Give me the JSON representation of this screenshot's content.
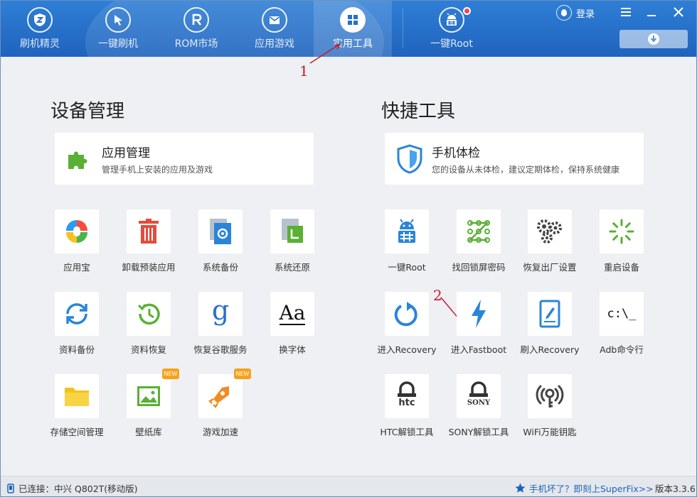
{
  "nav": {
    "tabs": [
      {
        "label": "刷机精灵",
        "icon": "shield-icon"
      },
      {
        "label": "一键刷机",
        "icon": "cursor-icon"
      },
      {
        "label": "ROM市场",
        "icon": "r-icon"
      },
      {
        "label": "应用游戏",
        "icon": "mail-icon"
      },
      {
        "label": "实用工具",
        "icon": "grid-icon",
        "active": true
      },
      {
        "label": "一键Root",
        "icon": "android-root-icon"
      }
    ],
    "login": "登录"
  },
  "annotations": {
    "one": "1",
    "two": "2"
  },
  "device_mgmt": {
    "title": "设备管理",
    "card": {
      "title": "应用管理",
      "subtitle": "管理手机上安装的应用及游戏"
    },
    "tiles": [
      "应用宝",
      "卸载预装应用",
      "系统备份",
      "系统还原",
      "资料备份",
      "资料恢复",
      "恢复谷歌服务",
      "换字体",
      "存储空间管理",
      "壁纸库",
      "游戏加速"
    ],
    "font_glyph": "Aa",
    "new_badge": "NEW"
  },
  "quick_tools": {
    "title": "快捷工具",
    "card": {
      "title": "手机体检",
      "subtitle": "您的设备从未体检，建议定期体检，保持系统健康"
    },
    "tiles": [
      "一键Root",
      "找回锁屏密码",
      "恢复出厂设置",
      "重启设备",
      "进入Recovery",
      "进入Fastboot",
      "刷入Recovery",
      "Adb命令行",
      "HTC解锁工具",
      "SONY解锁工具",
      "WiFi万能钥匙"
    ],
    "adb_glyph": "c:\\_",
    "htc_glyph": "htc",
    "sony_glyph": "SONY"
  },
  "status": {
    "connected": "已连接：中兴 Q802T(移动版)",
    "superfix": "手机坏了？即刻上SuperFix>>",
    "version": "版本3.3.6"
  },
  "colors": {
    "header": "#2470cb",
    "accent": "#1f63bd",
    "annotation": "#c6172a",
    "badge": "#f7a21b"
  }
}
